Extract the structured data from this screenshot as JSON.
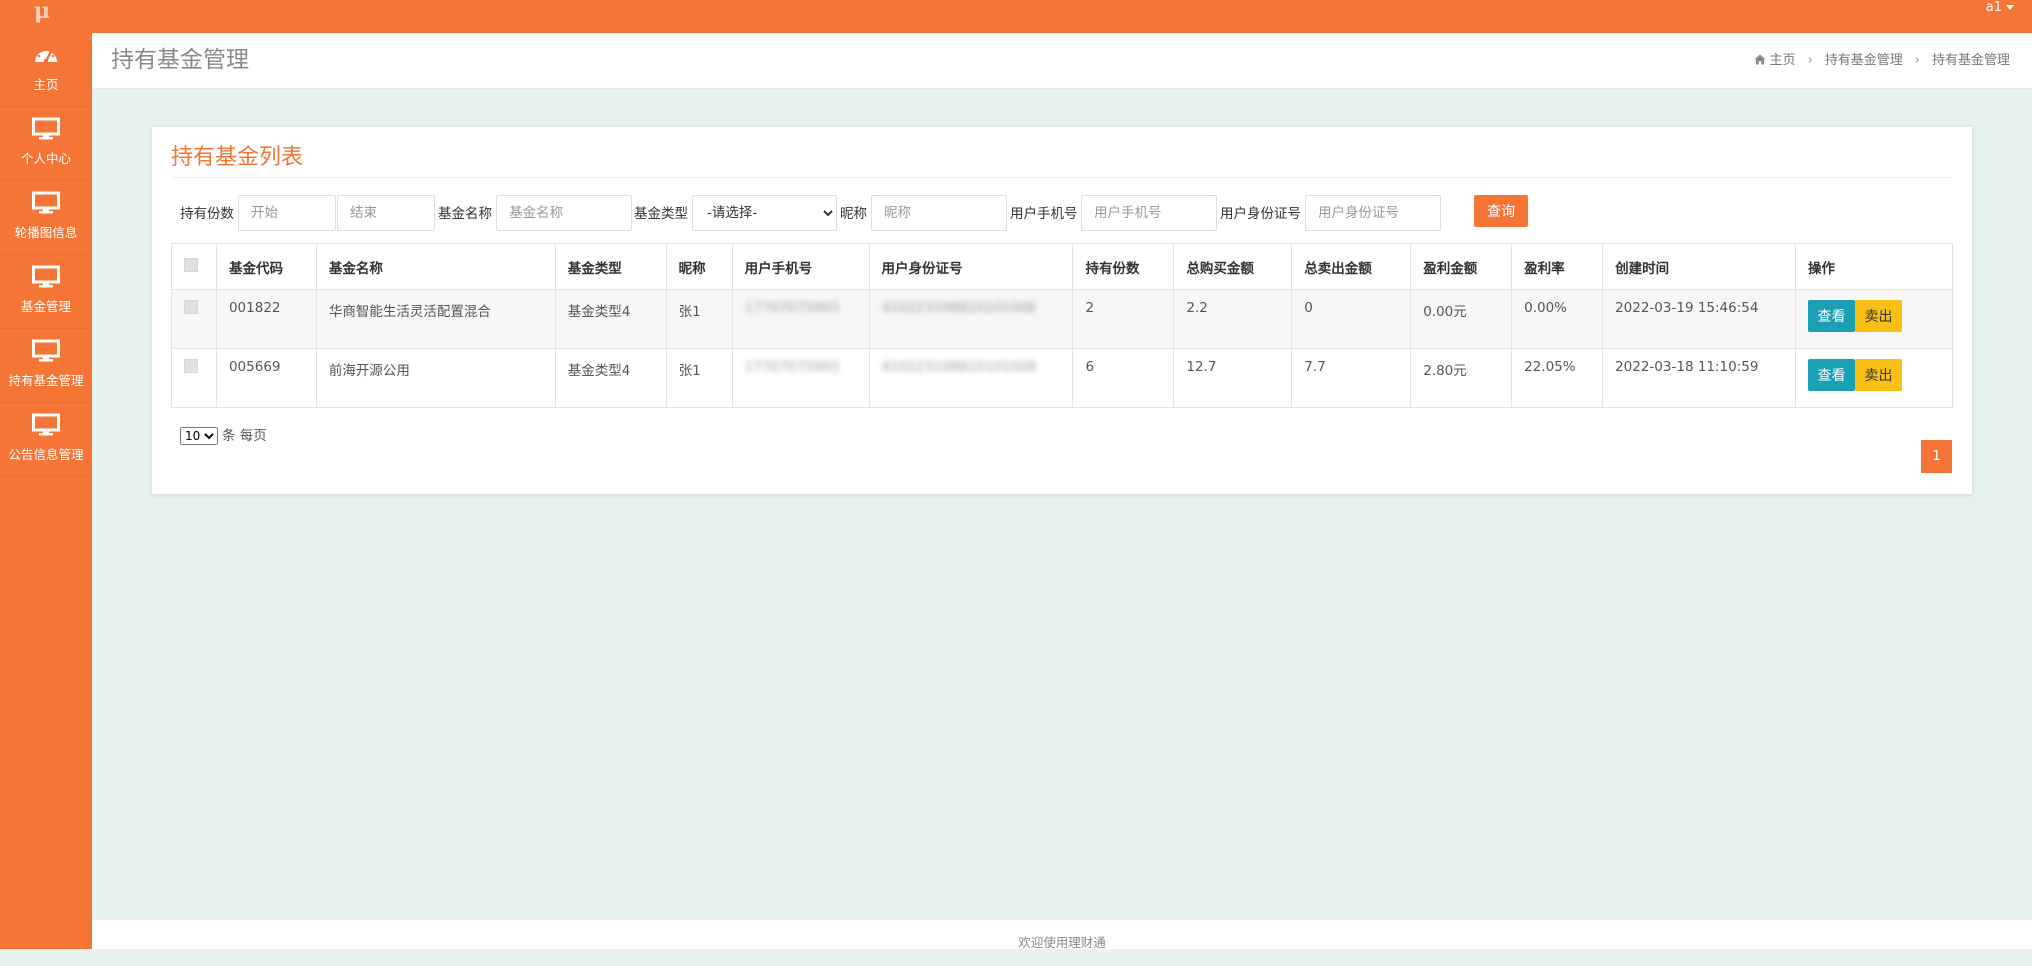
{
  "app": {
    "logo_text": "μ",
    "user_label": "a1"
  },
  "sidebar": {
    "items": [
      {
        "label": "主页",
        "icon": "dashboard-icon"
      },
      {
        "label": "个人中心",
        "icon": "monitor-icon"
      },
      {
        "label": "轮播图信息",
        "icon": "monitor-icon"
      },
      {
        "label": "基金管理",
        "icon": "monitor-icon"
      },
      {
        "label": "持有基金管理",
        "icon": "monitor-icon"
      },
      {
        "label": "公告信息管理",
        "icon": "monitor-icon"
      }
    ]
  },
  "header": {
    "title": "持有基金管理",
    "breadcrumb": [
      "主页",
      "持有基金管理",
      "持有基金管理"
    ]
  },
  "card": {
    "title": "持有基金列表"
  },
  "filters": {
    "shares_label": "持有份数",
    "shares_start_placeholder": "开始",
    "shares_end_placeholder": "结束",
    "fund_name_label": "基金名称",
    "fund_name_placeholder": "基金名称",
    "fund_type_label": "基金类型",
    "fund_type_selected": "-请选择-",
    "nickname_label": "昵称",
    "nickname_placeholder": "昵称",
    "phone_label": "用户手机号",
    "phone_placeholder": "用户手机号",
    "idcard_label": "用户身份证号",
    "idcard_placeholder": "用户身份证号",
    "search_label": "查询"
  },
  "table": {
    "headers": [
      "基金代码",
      "基金名称",
      "基金类型",
      "昵称",
      "用户手机号",
      "用户身份证号",
      "持有份数",
      "总购买金额",
      "总卖出金额",
      "盈利金额",
      "盈利率",
      "创建时间",
      "操作"
    ],
    "rows": [
      {
        "code": "001822",
        "name": "华商智能生活灵活配置混合",
        "type": "基金类型4",
        "nickname": "张1",
        "phone": "17707075993",
        "idcard": "410223198810101008",
        "shares": "2",
        "buy_total": "2.2",
        "sell_total": "0",
        "profit": "0.00元",
        "profit_rate": "0.00%",
        "created": "2022-03-19 15:46:54",
        "view_label": "查看",
        "sell_label": "卖出"
      },
      {
        "code": "005669",
        "name": "前海开源公用",
        "type": "基金类型4",
        "nickname": "张1",
        "phone": "17707075993",
        "idcard": "410223198810101008",
        "shares": "6",
        "buy_total": "12.7",
        "sell_total": "7.7",
        "profit": "2.80元",
        "profit_rate": "22.05%",
        "created": "2022-03-18 11:10:59",
        "view_label": "查看",
        "sell_label": "卖出"
      }
    ]
  },
  "pagination": {
    "page_size": "10",
    "page_size_suffix": "条 每页",
    "current_page": "1"
  },
  "footer": {
    "text": "欢迎使用理财通"
  },
  "colors": {
    "brand": "#f47535",
    "info": "#1a9fb5",
    "warning": "#f9c013"
  }
}
